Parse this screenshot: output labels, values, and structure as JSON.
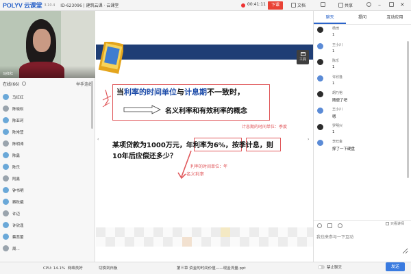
{
  "topbar": {
    "logo": "POLYV 云课堂",
    "version": "3.10.4",
    "room": "ID-623096 | 建筑云课 · 云课堂",
    "timer": "00:41:11",
    "end_label": "下课",
    "doc_label": "文档",
    "share_label": "共享",
    "colors": {
      "accent": "#2a63c9",
      "end": "#e94235"
    }
  },
  "video": {
    "name": "马红红"
  },
  "online": {
    "title": "在线(66)",
    "hand_label": "举手连线",
    "users": [
      "马红红",
      "陈晓松",
      "陈亚珂",
      "陈常营",
      "陈明涛",
      "陈鑫",
      "陈乐",
      "阿鑫",
      "钟书明",
      "察秋娥",
      "许迈",
      "许欣逢",
      "蔡蕊蕾",
      "周..."
    ]
  },
  "status": {
    "cpu": "CPU: 14.1%",
    "network": "网络良好",
    "switch_board": "切换到白板",
    "file": "第三章 资金的时间价值——现金流量.ppt"
  },
  "slide": {
    "tool_label": "工具",
    "title_a": "当",
    "title_b": "利率的时间单位",
    "title_c": "与",
    "title_d": "计息期",
    "title_e": "不一致时，",
    "sub": "名义利率和有效利率的概念",
    "q_a": "某项贷款为1000万元，",
    "q_b": "年利率为6%",
    "q_c": "，",
    "q_d": "按季计息",
    "q_e": "，则",
    "q2": "10年后应偿还多少？",
    "ann1": "计息期的时间单位：季度",
    "ann2": "利率的时间单位：年",
    "ann3": "名义利率"
  },
  "chat": {
    "tabs": [
      "聊天",
      "提问",
      "互动应用"
    ],
    "messages": [
      {
        "name": "杨琦",
        "text": "1"
      },
      {
        "name": "王小川",
        "text": "1"
      },
      {
        "name": "陈乐",
        "text": "1"
      },
      {
        "name": "许欣逢",
        "text": "1"
      },
      {
        "name": "胡乃裕",
        "text": "随便了吧"
      },
      {
        "name": "王小川",
        "text": "嗯"
      },
      {
        "name": "罗明兴",
        "text": "1"
      },
      {
        "name": "李旺金",
        "text": "撑了一下硬盘"
      }
    ],
    "only_teacher": "只看讲师",
    "placeholder": "我也来参与一下互动",
    "mute": "禁止聊天",
    "send": "发送"
  }
}
